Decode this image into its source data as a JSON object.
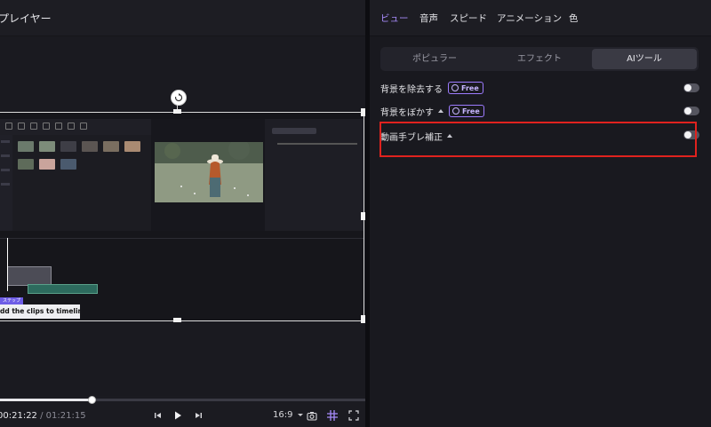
{
  "player": {
    "title": "プレイヤー",
    "overlay_tag": "ステップ",
    "overlay_caption": "dd the clips to timeline!",
    "current_time": "00:21:22",
    "time_separator": " / ",
    "total_time": "01:21:15",
    "aspect_ratio": "16:9",
    "progress_percent": 25
  },
  "panel": {
    "tabs": [
      {
        "label": "ビュー",
        "active": true
      },
      {
        "label": "音声",
        "active": false
      },
      {
        "label": "スピード",
        "active": false
      },
      {
        "label": "アニメーション",
        "active": false
      },
      {
        "label": "色",
        "active": false
      }
    ],
    "segments": [
      {
        "label": "ポピュラー",
        "active": false
      },
      {
        "label": "エフェクト",
        "active": false
      },
      {
        "label": "AIツール",
        "active": true
      }
    ],
    "features": [
      {
        "label": "背景を除去する",
        "badge": "Free",
        "caret": false,
        "enabled": false
      },
      {
        "label": "背景をぼかす",
        "badge": "Free",
        "caret": true,
        "enabled": false
      },
      {
        "label": "動画手ブレ補正",
        "badge": "",
        "caret": true,
        "enabled": false
      }
    ]
  },
  "colors": {
    "accent": "#a78bfa",
    "highlight": "#e0221e"
  }
}
